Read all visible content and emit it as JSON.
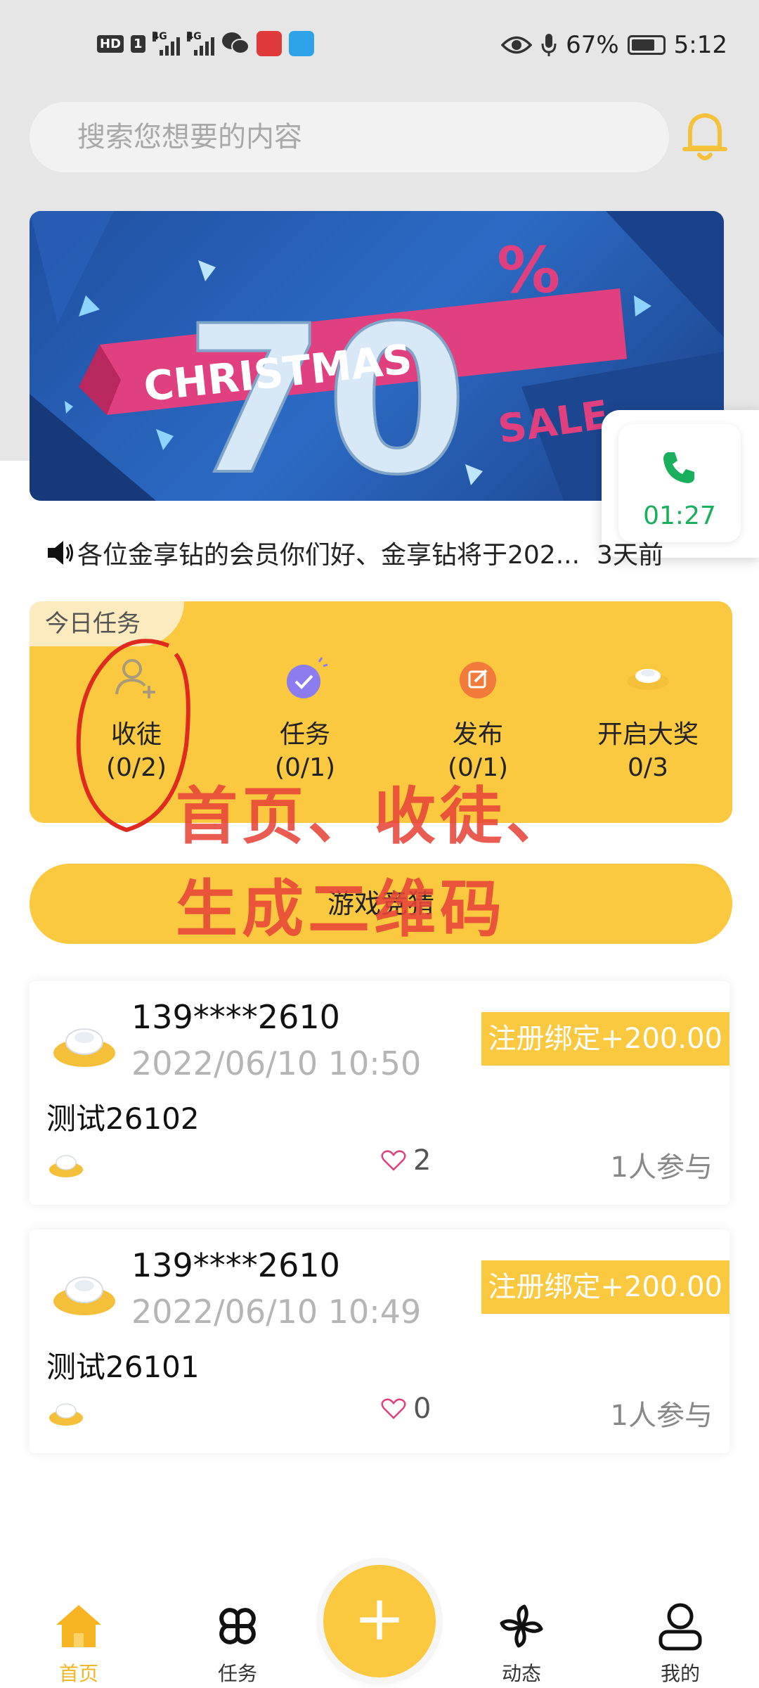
{
  "status_bar": {
    "hd": "HD",
    "sim": "1",
    "net1": "4G",
    "net2": "4G",
    "battery_percent": "67%",
    "time": "5:12",
    "icons": [
      "eye-icon",
      "mic-icon",
      "battery-icon",
      "wechat-icon",
      "app-icon",
      "browser-icon"
    ]
  },
  "search": {
    "placeholder": "搜索您想要的内容"
  },
  "banner": {
    "number": "70",
    "percent": "%",
    "ribbon": "CHRISTMAS",
    "sale": "SALE"
  },
  "call_widget": {
    "timer": "01:27"
  },
  "notice": {
    "text": "各位金享钻的会员你们好、金享钻将于202...",
    "tail": "3天前"
  },
  "tasks": {
    "tag": "今日任务",
    "items": [
      {
        "label": "收徒",
        "count": "(0/2)"
      },
      {
        "label": "任务",
        "count": "(0/1)"
      },
      {
        "label": "发布",
        "count": "(0/1)"
      },
      {
        "label": "开启大奖",
        "count": "0/3"
      }
    ]
  },
  "annotation": {
    "line1": "首页、收徒、",
    "line2": "生成二维码"
  },
  "game_button": {
    "label": "游戏竞猜"
  },
  "feed": [
    {
      "phone": "139****2610",
      "date": "2022/06/10 10:50",
      "badge": "注册绑定+200.00",
      "title": "测试26102",
      "likes": "2",
      "participants": "1人参与"
    },
    {
      "phone": "139****2610",
      "date": "2022/06/10 10:49",
      "badge": "注册绑定+200.00",
      "title": "测试26101",
      "likes": "0",
      "participants": "1人参与"
    }
  ],
  "bottom_nav": {
    "items": [
      {
        "label": "首页",
        "active": true
      },
      {
        "label": "任务"
      },
      {
        "label": "动态"
      },
      {
        "label": "我的"
      }
    ],
    "fab": "+"
  },
  "colors": {
    "accent": "#fbc93f",
    "active_nav": "#f4b623",
    "annotation": "#e8463a",
    "call_green": "#1aaf5d"
  }
}
